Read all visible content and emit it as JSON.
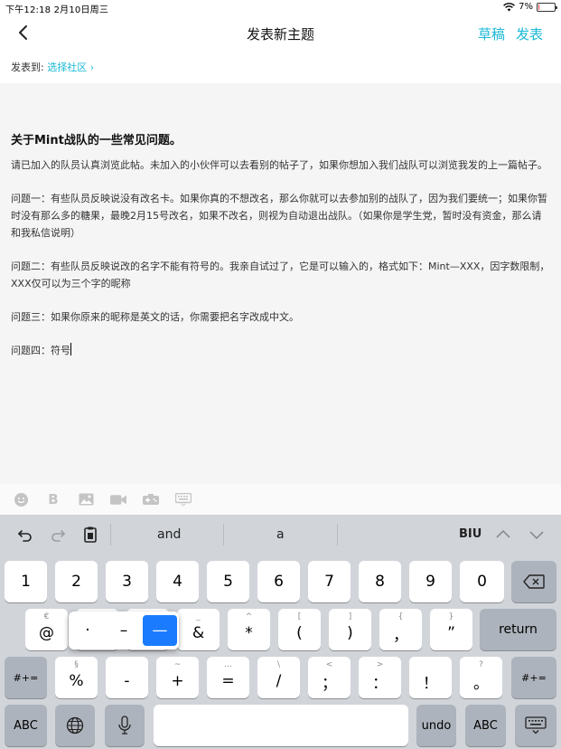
{
  "status_bar": {
    "time_date": "下午12:18   2月10日周三",
    "battery_percent": "7%",
    "battery_level": 0.07,
    "battery_color": "#e23b3b"
  },
  "nav": {
    "back_icon": "chevron-left-icon",
    "title": "发表新主题",
    "draft_label": "草稿",
    "post_label": "发表",
    "accent_color": "#1ab8d4"
  },
  "post_target": {
    "label": "发表到:",
    "link": "选择社区 ›"
  },
  "editor": {
    "title": "关于Mint战队的一些常见问题。",
    "paragraphs": [
      "请已加入的队员认真浏览此帖。未加入的小伙伴可以去看别的帖子了，如果你想加入我们战队可以浏览我发的上一篇帖子。",
      "问题一：有些队员反映说没有改名卡。如果你真的不想改名，那么你就可以去参加别的战队了，因为我们要统一；如果你暂时没有那么多的糖果，最晚2月15号改名，如果不改名，则视为自动退出战队。（如果你是学生党，暂时没有资金，那么请和我私信说明）",
      "问题二：有些队员反映说改的名字不能有符号的。我亲自试过了，它是可以输入的，格式如下：Mint—XXX，因字数限制，XXX仅可以为三个字的昵称",
      "问题三：如果你原来的昵称是英文的话，你需要把名字改成中文。",
      "问题四：符号"
    ]
  },
  "format_toolbar": {
    "icons": [
      "emoji-icon",
      "bold-icon",
      "image-icon",
      "video-icon",
      "game-icon",
      "keyboard-icon"
    ],
    "bold_glyph": "B"
  },
  "keyboard": {
    "suggestions": [
      "and",
      "a"
    ],
    "format_label": "BIU",
    "row1": [
      "1",
      "2",
      "3",
      "4",
      "5",
      "6",
      "7",
      "8",
      "9",
      "0"
    ],
    "row2": [
      {
        "sub": "€",
        "main": "@"
      },
      {
        "sub": "",
        "main": ""
      },
      {
        "sub": "",
        "main": ""
      },
      {
        "sub": "_",
        "main": "&"
      },
      {
        "sub": "^",
        "main": "*"
      },
      {
        "sub": "[",
        "main": "("
      },
      {
        "sub": "]",
        "main": ")"
      },
      {
        "sub": "{",
        "main": "，"
      },
      {
        "sub": "}",
        "main": "”"
      }
    ],
    "row3": [
      {
        "sub": "§",
        "main": "%"
      },
      {
        "sub": "",
        "main": "-"
      },
      {
        "sub": "~",
        "main": "+"
      },
      {
        "sub": "…",
        "main": "="
      },
      {
        "sub": "\\",
        "main": "/"
      },
      {
        "sub": "<",
        "main": "；"
      },
      {
        "sub": ">",
        "main": "："
      },
      {
        "sub": "！",
        "main": "！"
      },
      {
        "sub": "?",
        "main": "。"
      }
    ],
    "return_label": "return",
    "symbols_label": "#+=",
    "abc_label": "ABC",
    "undo_label": "undo",
    "popup_options": [
      "·",
      "–",
      "—"
    ],
    "popup_selected": "—",
    "selected_color": "#1b7bff"
  }
}
